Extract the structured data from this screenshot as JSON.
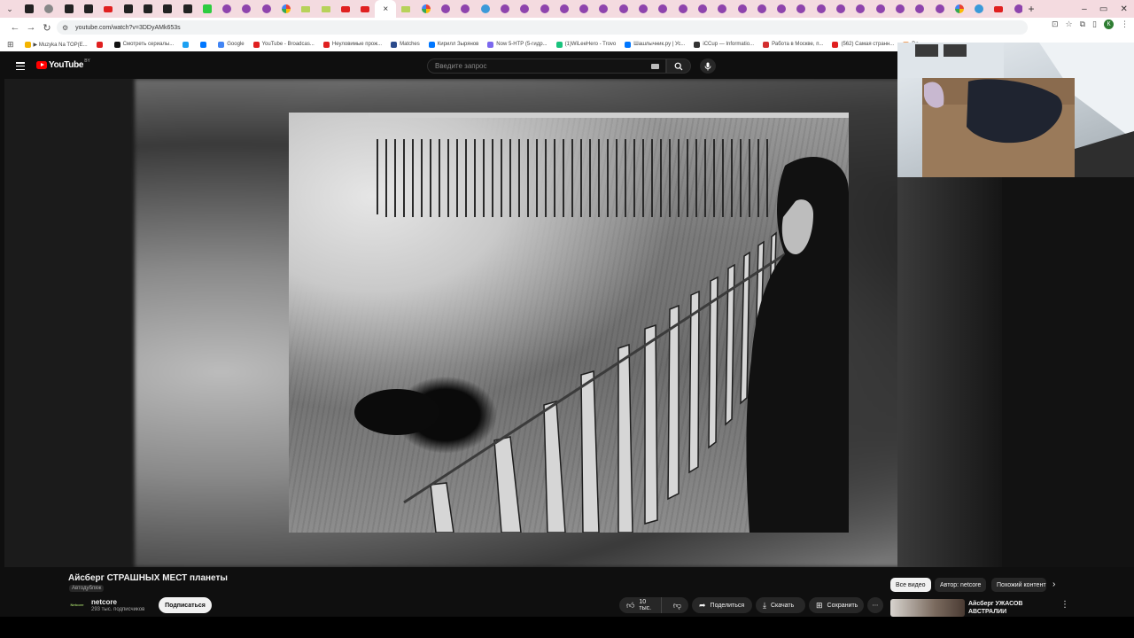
{
  "browser": {
    "url": "youtube.com/watch?v=3DDyAMk653s",
    "profile_initial": "К",
    "new_tab": "+",
    "close_tab": "×",
    "window_controls": [
      "–",
      "▭",
      "✕"
    ],
    "tabs": [
      "green-tab-icon",
      "purple-tab-icon",
      "red-tab-icon",
      "google-tab-icon"
    ]
  },
  "bookmarks": [
    {
      "label": "▶ Muzyka Na TOP(E...",
      "color": "#f4b400"
    },
    {
      "label": "",
      "color": "#e02020"
    },
    {
      "label": "Смотреть сериалы...",
      "color": "#111111"
    },
    {
      "label": "",
      "color": "#1da1f2"
    },
    {
      "label": "",
      "color": "#0077ff"
    },
    {
      "label": "Google",
      "color": "#4285f4"
    },
    {
      "label": "YouTube - Broadcas...",
      "color": "#e02020"
    },
    {
      "label": "Неуловимые прож...",
      "color": "#e02020"
    },
    {
      "label": "Matches",
      "color": "#2b4a8b"
    },
    {
      "label": "Кирилл Зырянов",
      "color": "#0077ff"
    },
    {
      "label": "Now 5-HTP (5-гидр...",
      "color": "#7b68ee"
    },
    {
      "label": "(1)WiLeeHero - Trovo",
      "color": "#19c37d"
    },
    {
      "label": "Шашлычник.ру | Ус...",
      "color": "#0077ff"
    },
    {
      "label": "iCCup — Informatio...",
      "color": "#333333"
    },
    {
      "label": "Работа в Москве, п...",
      "color": "#d32f2f"
    },
    {
      "label": "(562) Самая странн...",
      "color": "#e02020"
    },
    {
      "label": "Do...",
      "color": "#f4a261"
    }
  ],
  "youtube": {
    "logo_text": "YouTube",
    "region": "BY",
    "search_placeholder": "Введите запрос"
  },
  "video": {
    "title": "Айсберг СТРАШНЫХ МЕСТ планеты",
    "dub_badge": "Автодубляж",
    "channel_name": "netcore",
    "channel_avatar_text": "Netcore",
    "subscribers": "293 тыс. подписчиков",
    "subscribe_label": "Подписаться",
    "likes": "10 тыс.",
    "share_label": "Поделиться",
    "download_label": "Скачать",
    "save_label": "Сохранить",
    "more_label": "⋯"
  },
  "sidebar": {
    "chips": [
      "Все видео",
      "Автор: netcore",
      "Похожий контент"
    ],
    "next_arrow": "›",
    "recommendation_title": "Айсберг УЖАСОВ АВСТРАЛИИ",
    "rec_more": "⋮"
  },
  "colors": {
    "yt_red": "#ff0000",
    "background": "#0f0f0f",
    "tabstrip": "#f4dbe0"
  }
}
